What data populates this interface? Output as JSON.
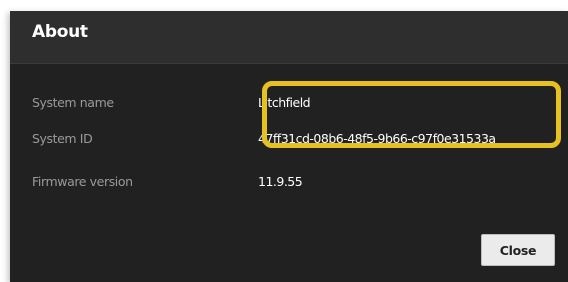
{
  "dialog": {
    "title": "About",
    "fields": [
      {
        "label": "System name",
        "value": "Litchfield"
      },
      {
        "label": "System ID",
        "value": "47ff31cd-08b6-48f5-9b66-c97f0e31533a"
      },
      {
        "label": "Firmware version",
        "value": "11.9.55"
      }
    ],
    "close_label": "Close"
  },
  "colors": {
    "dialog_bg": "#212121",
    "header_bg": "#2e2e2e",
    "label_text": "#9a9a9a",
    "value_text": "#ffffff",
    "highlight_outline": "#e7c021",
    "button_bg": "#ebebeb"
  }
}
